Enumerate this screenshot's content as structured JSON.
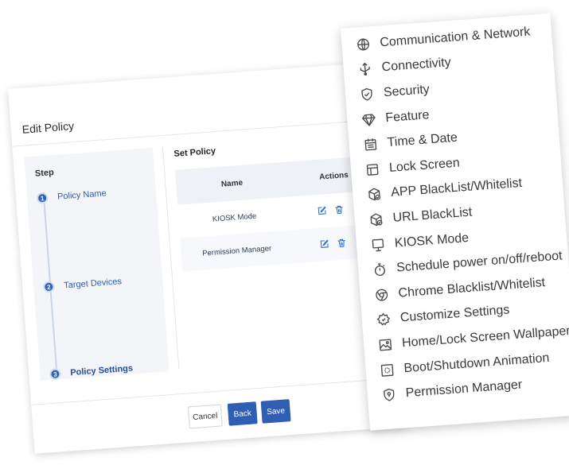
{
  "dialog": {
    "title": "Edit Policy",
    "step_heading": "Step",
    "steps": [
      {
        "number": "1",
        "label": "Policy Name"
      },
      {
        "number": "2",
        "label": "Target Devices"
      },
      {
        "number": "3",
        "label": "Policy Settings"
      }
    ],
    "set_policy_title": "Set Policy",
    "table": {
      "headers": {
        "name": "Name",
        "actions": "Actions"
      },
      "rows": [
        {
          "name": "KIOSK Mode"
        },
        {
          "name": "Permission Manager"
        }
      ]
    },
    "buttons": {
      "cancel": "Cancel",
      "back": "Back",
      "save": "Save"
    },
    "accent_color": "#2e5fb5"
  },
  "menu": {
    "items": [
      {
        "label": "Communication & Network",
        "icon": "globe-icon"
      },
      {
        "label": "Connectivity",
        "icon": "usb-icon"
      },
      {
        "label": "Security",
        "icon": "shield-check-icon"
      },
      {
        "label": "Feature",
        "icon": "diamond-icon"
      },
      {
        "label": "Time & Date",
        "icon": "calendar-icon"
      },
      {
        "label": "Lock Screen",
        "icon": "layout-icon"
      },
      {
        "label": "APP BlackList/Whitelist",
        "icon": "cube-check-icon"
      },
      {
        "label": "URL BlackList",
        "icon": "cube-check-icon"
      },
      {
        "label": "KIOSK Mode",
        "icon": "monitor-icon"
      },
      {
        "label": "Schedule power on/off/reboot",
        "icon": "stopwatch-icon"
      },
      {
        "label": "Chrome Blacklist/Whitelist",
        "icon": "chrome-icon"
      },
      {
        "label": "Customize Settings",
        "icon": "settings-icon"
      },
      {
        "label": "Home/Lock Screen Wallpaper",
        "icon": "image-icon"
      },
      {
        "label": "Boot/Shutdown Animation",
        "icon": "loading-icon"
      },
      {
        "label": "Permission Manager",
        "icon": "lock-shield-icon"
      }
    ]
  }
}
